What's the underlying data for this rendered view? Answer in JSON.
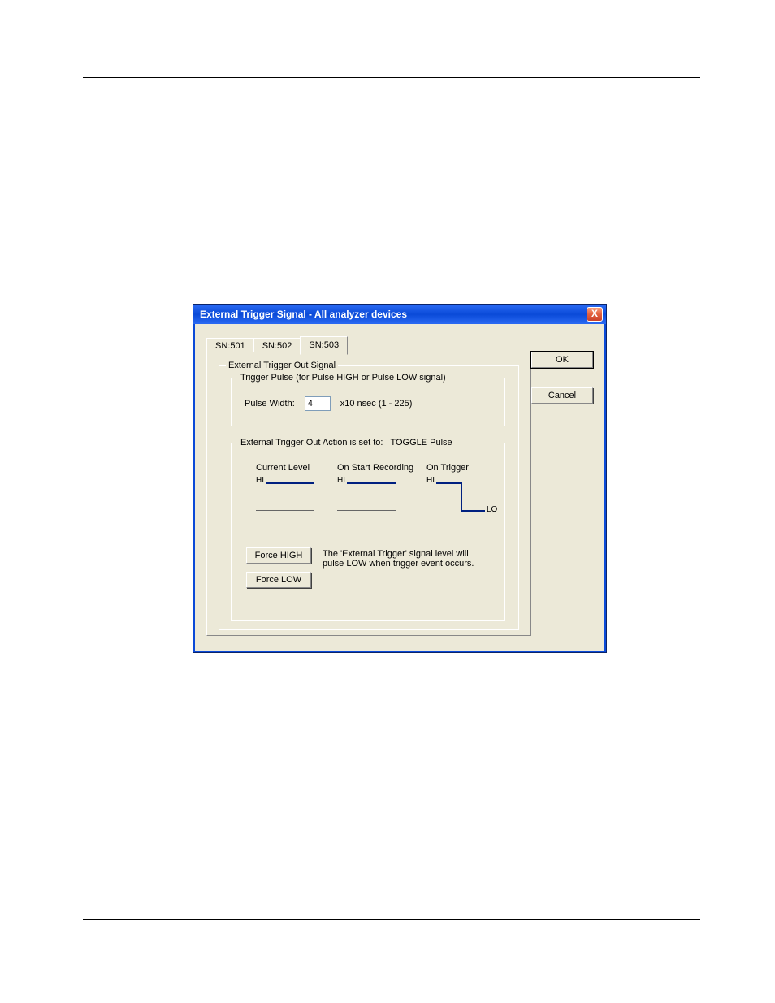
{
  "dialog": {
    "title": "External Trigger Signal - All analyzer devices",
    "close_symbol": "X"
  },
  "tabs": [
    {
      "label": "SN:501",
      "active": false
    },
    {
      "label": "SN:502",
      "active": false
    },
    {
      "label": "SN:503",
      "active": true
    }
  ],
  "group_out": {
    "legend": "External Trigger Out Signal",
    "pulse_group_legend": "Trigger Pulse (for Pulse HIGH or Pulse LOW signal)",
    "pulse_width_label": "Pulse Width:",
    "pulse_width_value": "4",
    "pulse_width_units": "x10 nsec (1 - 225)"
  },
  "action": {
    "legend_prefix": "External Trigger Out Action is set to:",
    "legend_value": "TOGGLE Pulse",
    "col_current": "Current Level",
    "col_start": "On Start Recording",
    "col_trigger": "On Trigger",
    "hi": "HI",
    "lo": "LO",
    "force_high": "Force HIGH",
    "force_low": "Force LOW",
    "explain": "The 'External Trigger' signal level will pulse LOW when trigger event occurs."
  },
  "buttons": {
    "ok": "OK",
    "cancel": "Cancel"
  }
}
